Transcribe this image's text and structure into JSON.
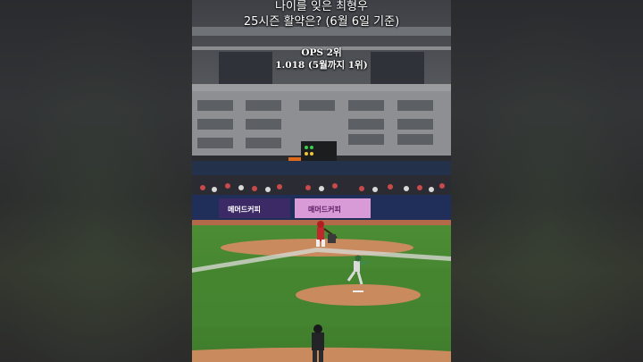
{
  "caption": {
    "title_line1": "나이를 잊은 최형우",
    "title_line2": "25시즌 활약은? (6월 6일 기준)",
    "stat_line1": "OPS 2위",
    "stat_line2": "1.018 (5월까지 1위)"
  },
  "outfield_ad": {
    "left_banner": "메머드커피",
    "right_banner": "매머드커피"
  }
}
